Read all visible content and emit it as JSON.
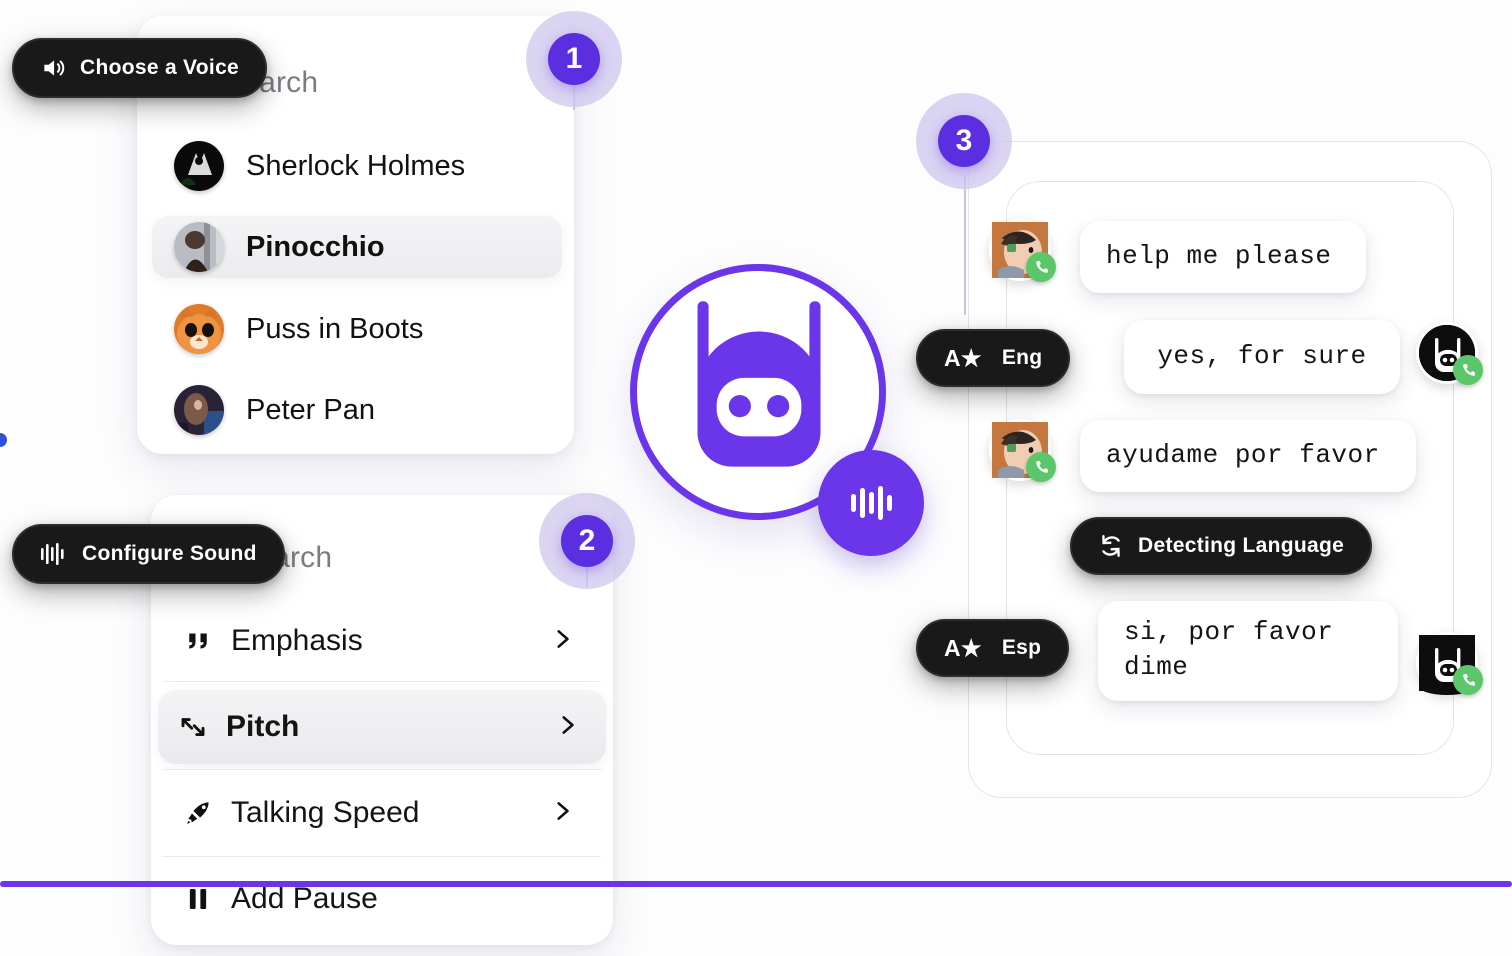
{
  "brand": {
    "accent": "#6b35ea",
    "badge_purple": "#5b2fe0",
    "halo_purple": "#cfc7ee",
    "dark_pill": "#191919",
    "green": "#5cc66b"
  },
  "steps": [
    {
      "number": "1"
    },
    {
      "number": "2"
    },
    {
      "number": "3"
    }
  ],
  "voice_panel": {
    "tooltip": {
      "label": "Choose a Voice",
      "icon": "speaker-icon"
    },
    "search_placeholder": "Search",
    "items": [
      {
        "name": "Sherlock Holmes",
        "avatar": "sherlock-avatar",
        "selected": false
      },
      {
        "name": "Pinocchio",
        "avatar": "pinocchio-avatar",
        "selected": true
      },
      {
        "name": "Puss in Boots",
        "avatar": "puss-in-boots-avatar",
        "selected": false
      },
      {
        "name": "Peter Pan",
        "avatar": "peter-pan-avatar",
        "selected": false
      }
    ]
  },
  "sound_panel": {
    "tooltip": {
      "label": "Configure Sound",
      "icon": "waveform-icon"
    },
    "search_placeholder": "Search",
    "items": [
      {
        "label": "Emphasis",
        "icon": "quote-icon",
        "selected": false,
        "chevron": true
      },
      {
        "label": "Pitch",
        "icon": "pitch-arrows-icon",
        "selected": true,
        "chevron": true
      },
      {
        "label": "Talking Speed",
        "icon": "rocket-icon",
        "selected": false,
        "chevron": true
      },
      {
        "label": "Add Pause",
        "icon": "pause-icon",
        "selected": false,
        "chevron": false
      }
    ]
  },
  "logo": {
    "name": "robot-logo",
    "wave_badge": "voice-wave-badge"
  },
  "chat_panel": {
    "language_tags": [
      {
        "icon": "A★",
        "label": "Eng"
      },
      {
        "icon": "A★",
        "label": "Esp"
      }
    ],
    "status_pill": {
      "label": "Detecting Language",
      "icon": "sync-icon"
    },
    "messages": [
      {
        "side": "left",
        "text": "help me please",
        "avatar": "user-avatar"
      },
      {
        "side": "right",
        "text": "yes, for sure",
        "avatar": "bot-avatar"
      },
      {
        "side": "left",
        "text": "ayudame por favor",
        "avatar": "user-avatar"
      },
      {
        "side": "right",
        "text": "si, por favor\ndime",
        "avatar": "bot-avatar"
      }
    ]
  }
}
